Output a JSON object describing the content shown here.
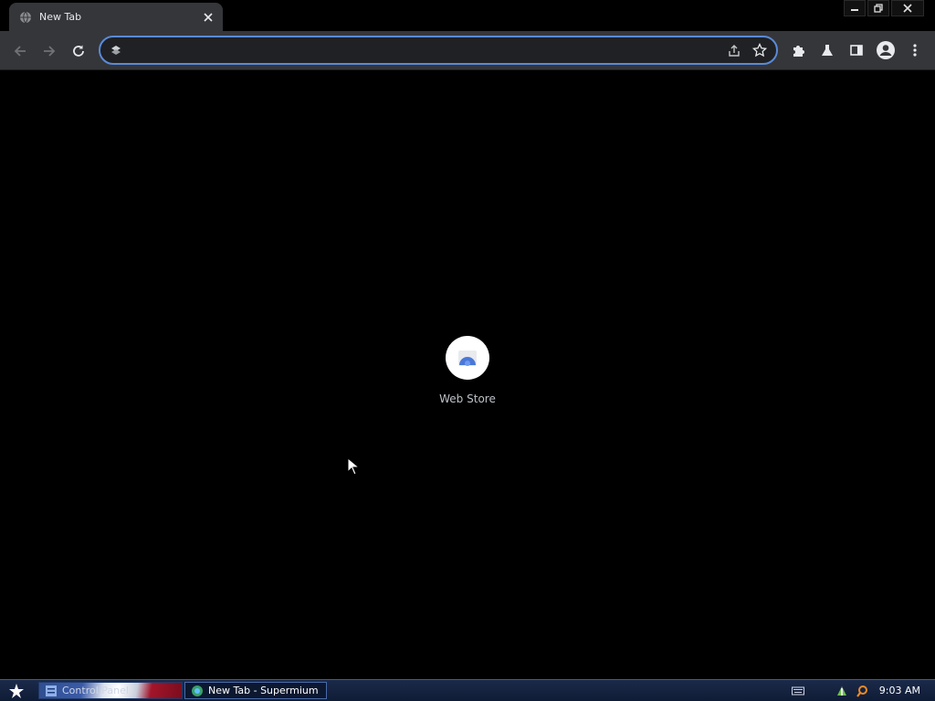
{
  "tab": {
    "title": "New Tab"
  },
  "omnibox": {
    "value": "",
    "placeholder": ""
  },
  "shortcuts": [
    {
      "label": "Web Store"
    }
  ],
  "taskbar": {
    "items": [
      {
        "label": "Control Panel"
      },
      {
        "label": "New Tab - Supermium"
      }
    ],
    "clock": "9:03 AM"
  },
  "colors": {
    "toolbar": "#35363a",
    "content_bg": "#000000",
    "omnibox_focus_ring": "#5a8ad8",
    "taskbar": "#1b2a4a"
  },
  "icons": {
    "tab_favicon": "globe-icon",
    "back": "arrow-left-icon",
    "forward": "arrow-right-icon",
    "reload": "reload-icon",
    "share": "share-icon",
    "bookmark": "star-icon",
    "extensions": "puzzle-icon",
    "labs": "flask-icon",
    "side_panel": "side-panel-icon",
    "profile": "profile-avatar-icon",
    "menu": "kebab-menu-icon"
  }
}
